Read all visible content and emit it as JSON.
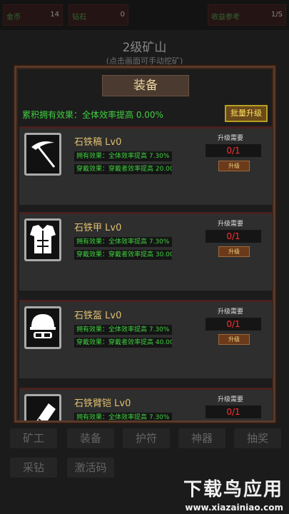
{
  "topbar": {
    "gold": {
      "label": "金币",
      "value": "14"
    },
    "diamond": {
      "label": "钻石",
      "value": "0"
    },
    "income": {
      "label": "收益参考",
      "value": "1/S"
    }
  },
  "scene": {
    "title": "2级矿山",
    "subtitle": "(点击画面可手动挖矿)"
  },
  "modal": {
    "title": "装备",
    "total_effect": "累积拥有效果：全体效率提高 0.00%",
    "batch_upgrade": "批量升级",
    "items": [
      {
        "name": "石铁稿 Lv0",
        "own": "拥有效果：全体效率提高 7.30%",
        "wear": "穿戴效果：穿戴者效率提高 20.00%",
        "need_label": "升级需要",
        "cost": "0/1",
        "upgrade": "升级",
        "icon": "pickaxe-icon"
      },
      {
        "name": "石铁甲 Lv0",
        "own": "拥有效果：全体效率提高 7.30%",
        "wear": "穿戴效果：穿戴者效率提高 30.00%",
        "need_label": "升级需要",
        "cost": "0/1",
        "upgrade": "升级",
        "icon": "armor-icon"
      },
      {
        "name": "石铁盔 Lv0",
        "own": "拥有效果：全体效率提高 7.30%",
        "wear": "穿戴效果：穿戴者效率提高 40.00%",
        "need_label": "升级需要",
        "cost": "0/1",
        "upgrade": "升级",
        "icon": "helmet-icon"
      },
      {
        "name": "石铁臂铠 Lv0",
        "own": "拥有效果：全体效率提高 7.30%",
        "wear": "",
        "need_label": "升级需要",
        "cost": "0/1",
        "upgrade": "",
        "icon": "bracer-icon"
      }
    ]
  },
  "nav": {
    "miner": "矿工",
    "equip": "装备",
    "amulet": "护符",
    "artifact": "神器",
    "lottery": "抽奖",
    "drill": "采钻",
    "activate": "激活码"
  },
  "watermark": {
    "big": "下载鸟应用",
    "small": "www.xiazainiao.com"
  },
  "colors": {
    "accent_green": "#3fcf3f",
    "cost_red": "#ff3030",
    "gold_text": "#e0c070"
  }
}
